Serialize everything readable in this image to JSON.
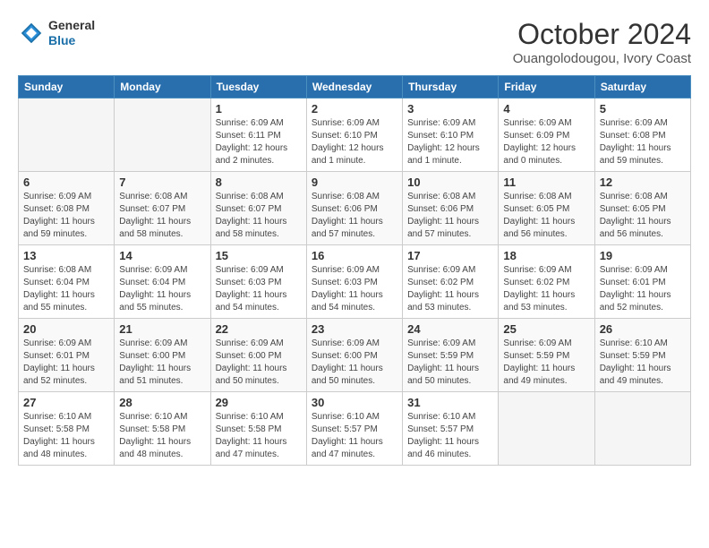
{
  "logo": {
    "general": "General",
    "blue": "Blue"
  },
  "header": {
    "month": "October 2024",
    "location": "Ouangolodougou, Ivory Coast"
  },
  "weekdays": [
    "Sunday",
    "Monday",
    "Tuesday",
    "Wednesday",
    "Thursday",
    "Friday",
    "Saturday"
  ],
  "weeks": [
    [
      {
        "day": "",
        "info": ""
      },
      {
        "day": "",
        "info": ""
      },
      {
        "day": "1",
        "info": "Sunrise: 6:09 AM\nSunset: 6:11 PM\nDaylight: 12 hours\nand 2 minutes."
      },
      {
        "day": "2",
        "info": "Sunrise: 6:09 AM\nSunset: 6:10 PM\nDaylight: 12 hours\nand 1 minute."
      },
      {
        "day": "3",
        "info": "Sunrise: 6:09 AM\nSunset: 6:10 PM\nDaylight: 12 hours\nand 1 minute."
      },
      {
        "day": "4",
        "info": "Sunrise: 6:09 AM\nSunset: 6:09 PM\nDaylight: 12 hours\nand 0 minutes."
      },
      {
        "day": "5",
        "info": "Sunrise: 6:09 AM\nSunset: 6:08 PM\nDaylight: 11 hours\nand 59 minutes."
      }
    ],
    [
      {
        "day": "6",
        "info": "Sunrise: 6:09 AM\nSunset: 6:08 PM\nDaylight: 11 hours\nand 59 minutes."
      },
      {
        "day": "7",
        "info": "Sunrise: 6:08 AM\nSunset: 6:07 PM\nDaylight: 11 hours\nand 58 minutes."
      },
      {
        "day": "8",
        "info": "Sunrise: 6:08 AM\nSunset: 6:07 PM\nDaylight: 11 hours\nand 58 minutes."
      },
      {
        "day": "9",
        "info": "Sunrise: 6:08 AM\nSunset: 6:06 PM\nDaylight: 11 hours\nand 57 minutes."
      },
      {
        "day": "10",
        "info": "Sunrise: 6:08 AM\nSunset: 6:06 PM\nDaylight: 11 hours\nand 57 minutes."
      },
      {
        "day": "11",
        "info": "Sunrise: 6:08 AM\nSunset: 6:05 PM\nDaylight: 11 hours\nand 56 minutes."
      },
      {
        "day": "12",
        "info": "Sunrise: 6:08 AM\nSunset: 6:05 PM\nDaylight: 11 hours\nand 56 minutes."
      }
    ],
    [
      {
        "day": "13",
        "info": "Sunrise: 6:08 AM\nSunset: 6:04 PM\nDaylight: 11 hours\nand 55 minutes."
      },
      {
        "day": "14",
        "info": "Sunrise: 6:09 AM\nSunset: 6:04 PM\nDaylight: 11 hours\nand 55 minutes."
      },
      {
        "day": "15",
        "info": "Sunrise: 6:09 AM\nSunset: 6:03 PM\nDaylight: 11 hours\nand 54 minutes."
      },
      {
        "day": "16",
        "info": "Sunrise: 6:09 AM\nSunset: 6:03 PM\nDaylight: 11 hours\nand 54 minutes."
      },
      {
        "day": "17",
        "info": "Sunrise: 6:09 AM\nSunset: 6:02 PM\nDaylight: 11 hours\nand 53 minutes."
      },
      {
        "day": "18",
        "info": "Sunrise: 6:09 AM\nSunset: 6:02 PM\nDaylight: 11 hours\nand 53 minutes."
      },
      {
        "day": "19",
        "info": "Sunrise: 6:09 AM\nSunset: 6:01 PM\nDaylight: 11 hours\nand 52 minutes."
      }
    ],
    [
      {
        "day": "20",
        "info": "Sunrise: 6:09 AM\nSunset: 6:01 PM\nDaylight: 11 hours\nand 52 minutes."
      },
      {
        "day": "21",
        "info": "Sunrise: 6:09 AM\nSunset: 6:00 PM\nDaylight: 11 hours\nand 51 minutes."
      },
      {
        "day": "22",
        "info": "Sunrise: 6:09 AM\nSunset: 6:00 PM\nDaylight: 11 hours\nand 50 minutes."
      },
      {
        "day": "23",
        "info": "Sunrise: 6:09 AM\nSunset: 6:00 PM\nDaylight: 11 hours\nand 50 minutes."
      },
      {
        "day": "24",
        "info": "Sunrise: 6:09 AM\nSunset: 5:59 PM\nDaylight: 11 hours\nand 50 minutes."
      },
      {
        "day": "25",
        "info": "Sunrise: 6:09 AM\nSunset: 5:59 PM\nDaylight: 11 hours\nand 49 minutes."
      },
      {
        "day": "26",
        "info": "Sunrise: 6:10 AM\nSunset: 5:59 PM\nDaylight: 11 hours\nand 49 minutes."
      }
    ],
    [
      {
        "day": "27",
        "info": "Sunrise: 6:10 AM\nSunset: 5:58 PM\nDaylight: 11 hours\nand 48 minutes."
      },
      {
        "day": "28",
        "info": "Sunrise: 6:10 AM\nSunset: 5:58 PM\nDaylight: 11 hours\nand 48 minutes."
      },
      {
        "day": "29",
        "info": "Sunrise: 6:10 AM\nSunset: 5:58 PM\nDaylight: 11 hours\nand 47 minutes."
      },
      {
        "day": "30",
        "info": "Sunrise: 6:10 AM\nSunset: 5:57 PM\nDaylight: 11 hours\nand 47 minutes."
      },
      {
        "day": "31",
        "info": "Sunrise: 6:10 AM\nSunset: 5:57 PM\nDaylight: 11 hours\nand 46 minutes."
      },
      {
        "day": "",
        "info": ""
      },
      {
        "day": "",
        "info": ""
      }
    ]
  ]
}
